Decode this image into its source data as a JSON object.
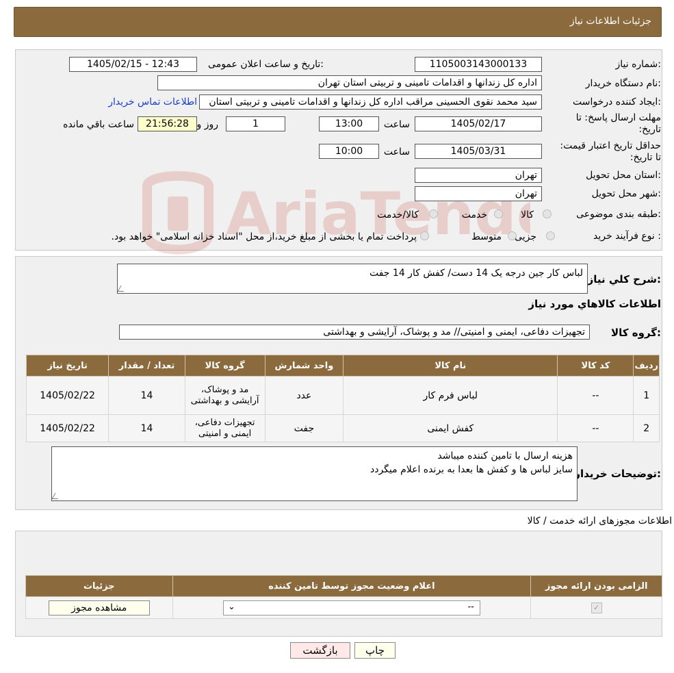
{
  "header": {
    "title": "جزئیات اطلاعات نیاز"
  },
  "watermark": {
    "text": "AriaTender.neT",
    "color": "#c0392b"
  },
  "details": {
    "need_number_label": "شماره نیاز:",
    "need_number": "1105003143000133",
    "announce_label": "تاریخ و ساعت اعلان عمومی:",
    "announce_value": "1405/02/15 - 12:43",
    "buyer_label": "نام دستگاه خریدار:",
    "buyer_value": "اداره کل زندانها و اقدامات تامینی و تربیتی استان تهران",
    "creator_label": "ایجاد کننده درخواست:",
    "creator_value": "سید محمد نقوی الحسینی مراقب  اداره کل زندانها و اقدامات تامینی و تربیتی استان",
    "contact_link": "اطلاعات تماس خریدار",
    "deadline_label": "مهلت ارسال پاسخ: تا تاریخ:",
    "deadline_date": "1405/02/17",
    "time_label": "ساعت",
    "deadline_time": "13:00",
    "days_value": "1",
    "days_label": "روز و",
    "remaining_time": "21:56:28",
    "remaining_label": "ساعت باقي مانده",
    "validity_label": "حداقل تاریخ اعتبار قیمت: تا تاریخ:",
    "validity_date": "1405/03/31",
    "validity_time": "10:00",
    "province_label": "استان محل تحویل:",
    "province_value": "تهران",
    "city_label": "شهر محل تحویل:",
    "city_value": "تهران",
    "category_label": "طبقه بندی موضوعی:",
    "category_options": [
      "کالا",
      "خدمت",
      "کالا/خدمت"
    ],
    "process_label": "نوع فرآیند خرید :",
    "process_options": [
      "جزیی",
      "متوسط"
    ],
    "process_note": "پرداخت تمام یا بخشی از مبلغ خرید،از محل \"اسناد خزانه اسلامی\" خواهد بود."
  },
  "summary": {
    "desc_label": "شرح کلي نياز:",
    "desc_value": "لباس کار جین درجه یک 14 دست/ کفش کار 14 جفت",
    "goods_title": "اطلاعات کالاهاي مورد نياز",
    "group_label": "گروه کالا:",
    "group_value": "تجهیزات دفاعی، ایمنی و امنیتی// مد و پوشاک، آرایشی و بهداشتی"
  },
  "goods_table": {
    "headers": [
      "رديف",
      "کد کالا",
      "نام کالا",
      "واحد شمارش",
      "گروه کالا",
      "تعداد / مقدار",
      "تاریخ نیاز"
    ],
    "rows": [
      [
        "1",
        "--",
        "لباس فرم کار",
        "عدد",
        "مد و پوشاک، آرایشی و بهداشتی",
        "14",
        "1405/02/22"
      ],
      [
        "2",
        "--",
        "کفش ایمنی",
        "جفت",
        "تجهیزات دفاعی، ایمنی و امنیتی",
        "14",
        "1405/02/22"
      ]
    ]
  },
  "buyer_notes": {
    "label": "توضیحات خریدار:",
    "line1": "هزینه ارسال با تامین کننده میباشد",
    "line2": "سایز لباس ها و کفش ها بعدا به برنده اعلام میگردد"
  },
  "permits": {
    "title": "اطلاعات مجوزهای ارائه خدمت / کالا",
    "headers": [
      "الزامی بودن ارائه مجوز",
      "اعلام وضعیت مجوز توسط تامین کننده",
      "جزئیات"
    ],
    "select_value": "--",
    "view_button": "مشاهده مجوز"
  },
  "footer": {
    "print_label": "چاپ",
    "back_label": "بازگشت",
    "print_bg": "#ffffee",
    "back_bg": "#ffe8e8"
  }
}
